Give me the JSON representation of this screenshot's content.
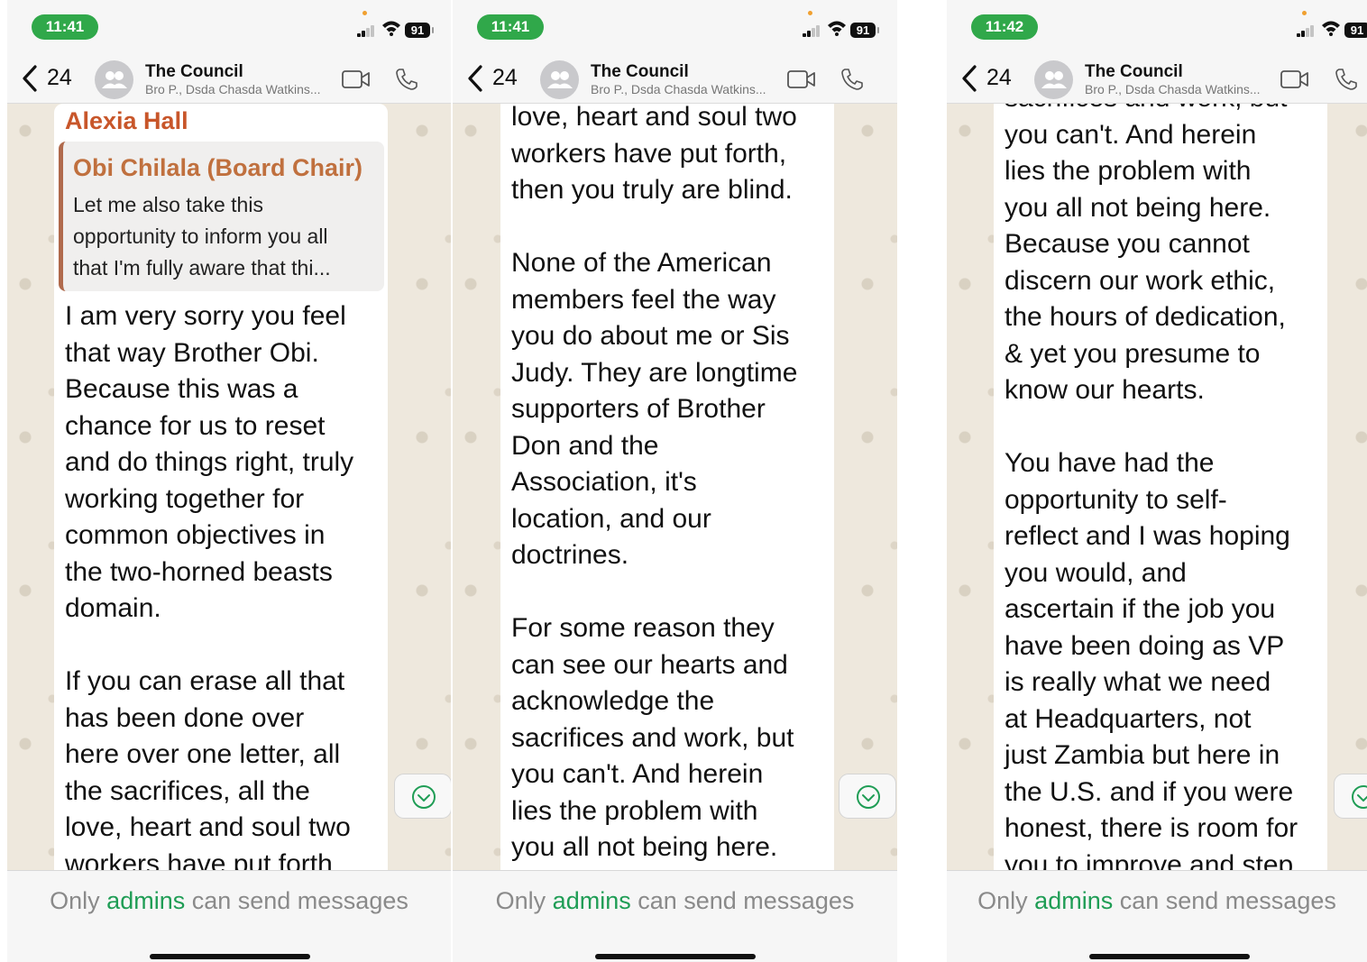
{
  "colors": {
    "status_green": "#30a84a",
    "sender_name": "#c8562a",
    "quote_author": "#c0703e",
    "admins_link": "#1f9d55",
    "chat_bg": "#eee8dd"
  },
  "footer": {
    "prefix": "Only ",
    "link": "admins",
    "suffix": " can send messages"
  },
  "chat": {
    "back_count": "24",
    "title": "The Council",
    "subtitle": "Bro P., Dsda Chasda Watkins..."
  },
  "icons": {
    "back": "chevron-left-icon",
    "avatar": "group-icon",
    "video": "video-camera-icon",
    "call": "phone-icon",
    "scroll_down": "chevron-down-circle-icon"
  },
  "panels": [
    {
      "time": "11:41",
      "battery": "91",
      "sender": "Alexia Hall",
      "quote_author": "Obi Chilala (Board Chair)",
      "quote_lines": [
        "Let me also take this",
        "opportunity to inform you all",
        "that I'm fully aware that thi..."
      ],
      "lines": [
        "I am very sorry you feel",
        "that way Brother Obi.",
        "Because this was a",
        "chance for us to reset",
        "and do things right, truly",
        "working together for",
        "common objectives in",
        "the two-horned beasts",
        "domain.",
        "",
        "If you can erase all that",
        "has been done over",
        "here over one letter, all",
        "the sacrifices, all the",
        "love, heart and soul two",
        "workers have put forth"
      ]
    },
    {
      "time": "11:41",
      "battery": "91",
      "lines": [
        "love, heart and soul two",
        "workers have put forth,",
        "then you truly are blind.",
        "",
        "None of the American",
        "members feel the way",
        "you do about me or Sis",
        "Judy. They are longtime",
        "supporters of Brother",
        "Don and the",
        "Association, it's",
        "location, and our",
        "doctrines.",
        "",
        "For some reason they",
        "can see our hearts and",
        "acknowledge the",
        "sacrifices and work, but",
        "you can't. And herein",
        "lies the problem with",
        "you all not being here."
      ]
    },
    {
      "time": "11:42",
      "battery": "91",
      "lines": [
        "sacrifices and work, but",
        "you can't. And herein",
        "lies the problem with",
        "you all not being here.",
        "Because you cannot",
        "discern our work ethic,",
        "the hours of dedication,",
        "& yet you presume to",
        "know our hearts.",
        "",
        "You have had the",
        "opportunity to self-",
        "reflect and I was hoping",
        "you would, and",
        "ascertain if the job you",
        "have been doing as VP",
        "is really what we need",
        "at Headquarters, not",
        "just Zambia but here in",
        "the U.S. and if you were",
        "honest, there is room for",
        "you to improve and step"
      ]
    }
  ]
}
